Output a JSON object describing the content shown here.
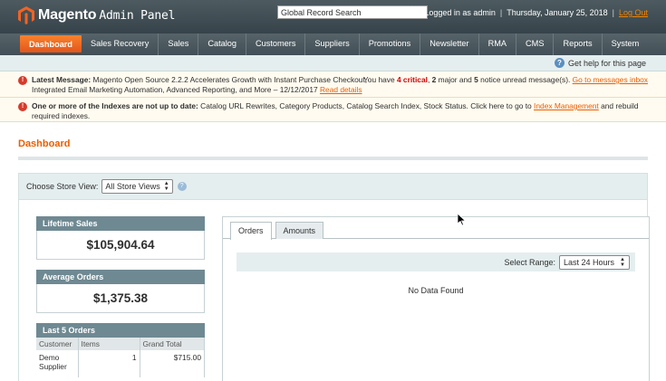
{
  "header": {
    "brand": "Magento",
    "brand_sub": "Admin Panel",
    "search_value": "Global Record Search",
    "logged_in": "Logged in as admin",
    "date": "Thursday, January 25, 2018",
    "logout": "Log Out"
  },
  "nav": {
    "items": [
      "Dashboard",
      "Sales Recovery",
      "Sales",
      "Catalog",
      "Customers",
      "Suppliers",
      "Promotions",
      "Newsletter",
      "RMA",
      "CMS",
      "Reports",
      "System"
    ],
    "help": "Get help for this page"
  },
  "messages": {
    "latest_label": "Latest Message:",
    "latest_text": "Magento Open Source 2.2.2 Accelerates Growth with Instant Purchase Checkout,",
    "latest_text2": "Integrated Email Marketing Automation, Advanced Reporting, and More – 12/12/2017",
    "read_details": "Read details",
    "you_have": "You have",
    "critical": "4 critical",
    "major_n": "2",
    "major_t": "major and",
    "notice_n": "5",
    "notice_t": "notice unread message(s).",
    "go_inbox": "Go to messages inbox",
    "index_bold": "One or more of the Indexes are not up to date:",
    "index_text": "Catalog URL Rewrites, Category Products, Catalog Search Index, Stock Status. Click here to go to",
    "index_link": "Index Management",
    "index_text2": "and rebuild",
    "index_text3": "required indexes."
  },
  "page": {
    "title": "Dashboard",
    "store_label": "Choose Store View:",
    "store_value": "All Store Views"
  },
  "stats": {
    "lifetime_label": "Lifetime Sales",
    "lifetime_value": "$105,904.64",
    "average_label": "Average Orders",
    "average_value": "$1,375.38",
    "last5_label": "Last 5 Orders",
    "columns": [
      "Customer",
      "Items",
      "Grand Total"
    ],
    "rows": [
      {
        "customer": "Demo Supplier",
        "items": "1",
        "total": "$715.00"
      }
    ]
  },
  "tabs": {
    "items": [
      "Orders",
      "Amounts"
    ],
    "range_label": "Select Range:",
    "range_value": "Last 24 Hours",
    "no_data": "No Data Found"
  },
  "colors": {
    "accent": "#eb5e00",
    "header": "#3f4c53",
    "critical": "#d30000"
  }
}
